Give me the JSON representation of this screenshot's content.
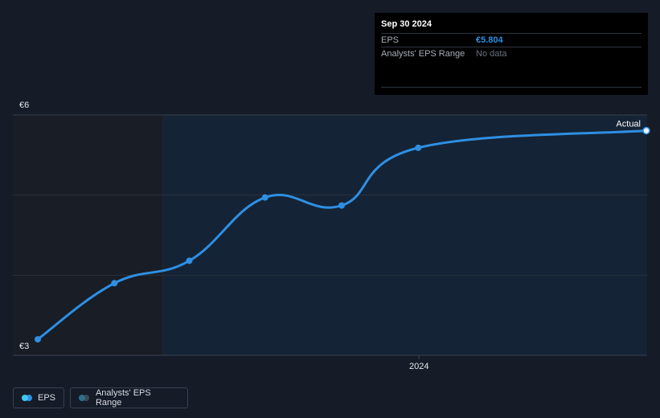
{
  "chart_data": {
    "type": "line",
    "ylabel": "",
    "xlabel": "",
    "y_ticks": [
      "€6",
      "€3"
    ],
    "ylim": [
      3,
      6
    ],
    "x_tick_labels": [
      {
        "label": "2024",
        "date": "2024-01-01"
      }
    ],
    "series": [
      {
        "name": "EPS",
        "color": "#2e8fe3",
        "points": [
          {
            "date": "2022-09-30",
            "value": 3.2
          },
          {
            "date": "2022-12-31",
            "value": 3.9
          },
          {
            "date": "2023-03-31",
            "value": 4.18
          },
          {
            "date": "2023-06-30",
            "value": 4.97
          },
          {
            "date": "2023-09-30",
            "value": 4.87
          },
          {
            "date": "2023-12-31",
            "value": 5.59
          },
          {
            "date": "2024-09-30",
            "value": 5.804
          }
        ]
      }
    ],
    "annotations": [
      {
        "label": "Actual",
        "date": "2024-09-30"
      }
    ],
    "grid": true
  },
  "tooltip": {
    "date": "Sep 30 2024",
    "rows": [
      {
        "label": "EPS",
        "value": "€5.804"
      },
      {
        "label": "Analysts' EPS Range",
        "value": "No data"
      }
    ]
  },
  "legend": {
    "items": [
      {
        "label": "EPS",
        "dot_colors": [
          "#3ec7f0",
          "#2e8fe3"
        ]
      },
      {
        "label": "Analysts' EPS Range",
        "dot_colors": [
          "#2f6f8a",
          "#3b4757"
        ]
      }
    ]
  },
  "colors": {
    "background": "#151b27",
    "past_region": "#181d26",
    "forecast_region": "#142335",
    "line": "#2e8fe3",
    "gridline": "#2a3340"
  }
}
